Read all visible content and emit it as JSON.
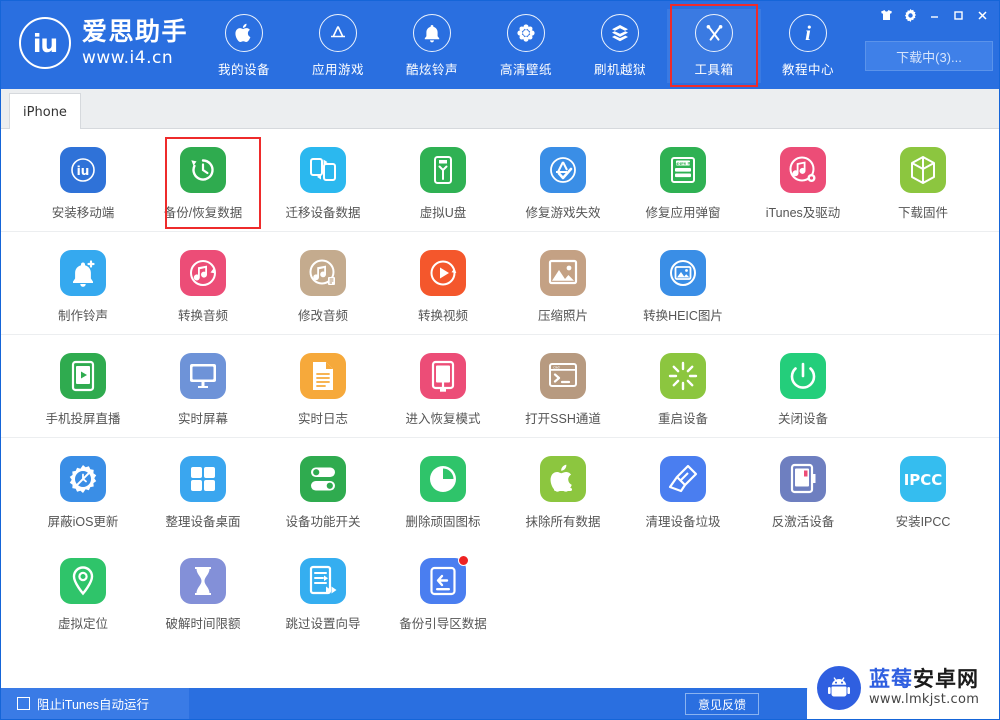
{
  "header": {
    "brand_logo_text": "iu",
    "brand_name": "爱思助手",
    "brand_url": "www.i4.cn",
    "accent_color": "#2a6fe0",
    "highlight_color": "#ee2b2b",
    "nav": [
      {
        "label": "我的设备",
        "icon": "apple-icon",
        "active": false
      },
      {
        "label": "应用游戏",
        "icon": "appstore-icon",
        "active": false
      },
      {
        "label": "酷炫铃声",
        "icon": "bell-icon",
        "active": false
      },
      {
        "label": "高清壁纸",
        "icon": "flower-icon",
        "active": false
      },
      {
        "label": "刷机越狱",
        "icon": "box-open-icon",
        "active": false
      },
      {
        "label": "工具箱",
        "icon": "tools-icon",
        "active": true
      },
      {
        "label": "教程中心",
        "icon": "info-icon",
        "active": false
      }
    ],
    "window_controls": [
      {
        "name": "skin-icon",
        "glyph": "shirt"
      },
      {
        "name": "gear-icon",
        "glyph": "gear"
      },
      {
        "name": "minimize-icon",
        "glyph": "minimize"
      },
      {
        "name": "maximize-icon",
        "glyph": "maximize"
      },
      {
        "name": "close-icon",
        "glyph": "close"
      }
    ],
    "download_button": "下载中(3)..."
  },
  "device_tab": {
    "label": "iPhone"
  },
  "groups": [
    {
      "rows": [
        [
          {
            "label": "安装移动端",
            "icon": "i4-app-icon",
            "bg": "#2f72d8",
            "highlight": false
          },
          {
            "label": "备份/恢复数据",
            "icon": "backup-restore-icon",
            "bg": "#2fab4f",
            "highlight": true
          },
          {
            "label": "迁移设备数据",
            "icon": "migrate-device-icon",
            "bg": "#2bb8ef",
            "highlight": false
          },
          {
            "label": "虚拟U盘",
            "icon": "usb-drive-icon",
            "bg": "#2fb153",
            "highlight": false
          },
          {
            "label": "修复游戏失效",
            "icon": "fix-game-icon",
            "bg": "#3a8ee6",
            "highlight": false
          },
          {
            "label": "修复应用弹窗",
            "icon": "apple-id-icon",
            "bg": "#2fb153",
            "highlight": false
          },
          {
            "label": "iTunes及驱动",
            "icon": "itunes-driver-icon",
            "bg": "#ec4d77",
            "highlight": false
          },
          {
            "label": "下载固件",
            "icon": "firmware-icon",
            "bg": "#8cc63f",
            "highlight": false
          }
        ]
      ]
    },
    {
      "rows": [
        [
          {
            "label": "制作铃声",
            "icon": "make-ringtone-icon",
            "bg": "#35a9ef",
            "highlight": false
          },
          {
            "label": "转换音频",
            "icon": "convert-audio-icon",
            "bg": "#ec4d77",
            "highlight": false
          },
          {
            "label": "修改音频",
            "icon": "edit-audio-icon",
            "bg": "#c4ab8e",
            "highlight": false
          },
          {
            "label": "转换视频",
            "icon": "convert-video-icon",
            "bg": "#f4572c",
            "highlight": false
          },
          {
            "label": "压缩照片",
            "icon": "compress-photo-icon",
            "bg": "#c4a184",
            "highlight": false
          },
          {
            "label": "转换HEIC图片",
            "icon": "convert-heic-icon",
            "bg": "#3a8ee6",
            "highlight": false
          }
        ]
      ]
    },
    {
      "rows": [
        [
          {
            "label": "手机投屏直播",
            "icon": "screen-cast-icon",
            "bg": "#2fab4f",
            "highlight": false
          },
          {
            "label": "实时屏幕",
            "icon": "realtime-screen-icon",
            "bg": "#6e93d8",
            "highlight": false
          },
          {
            "label": "实时日志",
            "icon": "realtime-log-icon",
            "bg": "#f6a93b",
            "highlight": false
          },
          {
            "label": "进入恢复模式",
            "icon": "recovery-mode-icon",
            "bg": "#ec4d77",
            "highlight": false
          },
          {
            "label": "打开SSH通道",
            "icon": "ssh-tunnel-icon",
            "bg": "#b79a80",
            "highlight": false
          },
          {
            "label": "重启设备",
            "icon": "restart-device-icon",
            "bg": "#8cc63f",
            "highlight": false
          },
          {
            "label": "关闭设备",
            "icon": "shutdown-device-icon",
            "bg": "#24ce7b",
            "highlight": false
          }
        ]
      ]
    },
    {
      "rows": [
        [
          {
            "label": "屏蔽iOS更新",
            "icon": "block-ios-update-icon",
            "bg": "#3a8ee6",
            "highlight": false
          },
          {
            "label": "整理设备桌面",
            "icon": "organize-desktop-icon",
            "bg": "#3aa6ef",
            "highlight": false
          },
          {
            "label": "设备功能开关",
            "icon": "feature-toggle-icon",
            "bg": "#2fab4f",
            "highlight": false
          },
          {
            "label": "删除顽固图标",
            "icon": "delete-icon-icon",
            "bg": "#2fc46a",
            "highlight": false
          },
          {
            "label": "抹除所有数据",
            "icon": "erase-all-icon",
            "bg": "#8cc63f",
            "highlight": false
          },
          {
            "label": "清理设备垃圾",
            "icon": "clean-junk-icon",
            "bg": "#4a7ef0",
            "highlight": false
          },
          {
            "label": "反激活设备",
            "icon": "deactivate-icon",
            "bg": "#6e7fc0",
            "highlight": false
          },
          {
            "label": "安装IPCC",
            "icon": "ipcc-icon",
            "bg": "#35bdef",
            "highlight": false,
            "text": "IPCC"
          }
        ],
        [
          {
            "label": "虚拟定位",
            "icon": "virtual-location-icon",
            "bg": "#2fc46a",
            "highlight": false
          },
          {
            "label": "破解时间限额",
            "icon": "time-limit-icon",
            "bg": "#8390d8",
            "highlight": false
          },
          {
            "label": "跳过设置向导",
            "icon": "skip-setup-icon",
            "bg": "#35aef0",
            "highlight": false
          },
          {
            "label": "备份引导区数据",
            "icon": "backup-boot-icon",
            "bg": "#4a7ef0",
            "highlight": false,
            "badge": true
          }
        ]
      ]
    }
  ],
  "statusbar": {
    "checkbox_label": "阻止iTunes自动运行",
    "checked": false,
    "feedback_label": "意见反馈"
  },
  "watermark": {
    "name_part1": "蓝莓",
    "name_part2": "安卓网",
    "url": "www.lmkjst.com"
  }
}
